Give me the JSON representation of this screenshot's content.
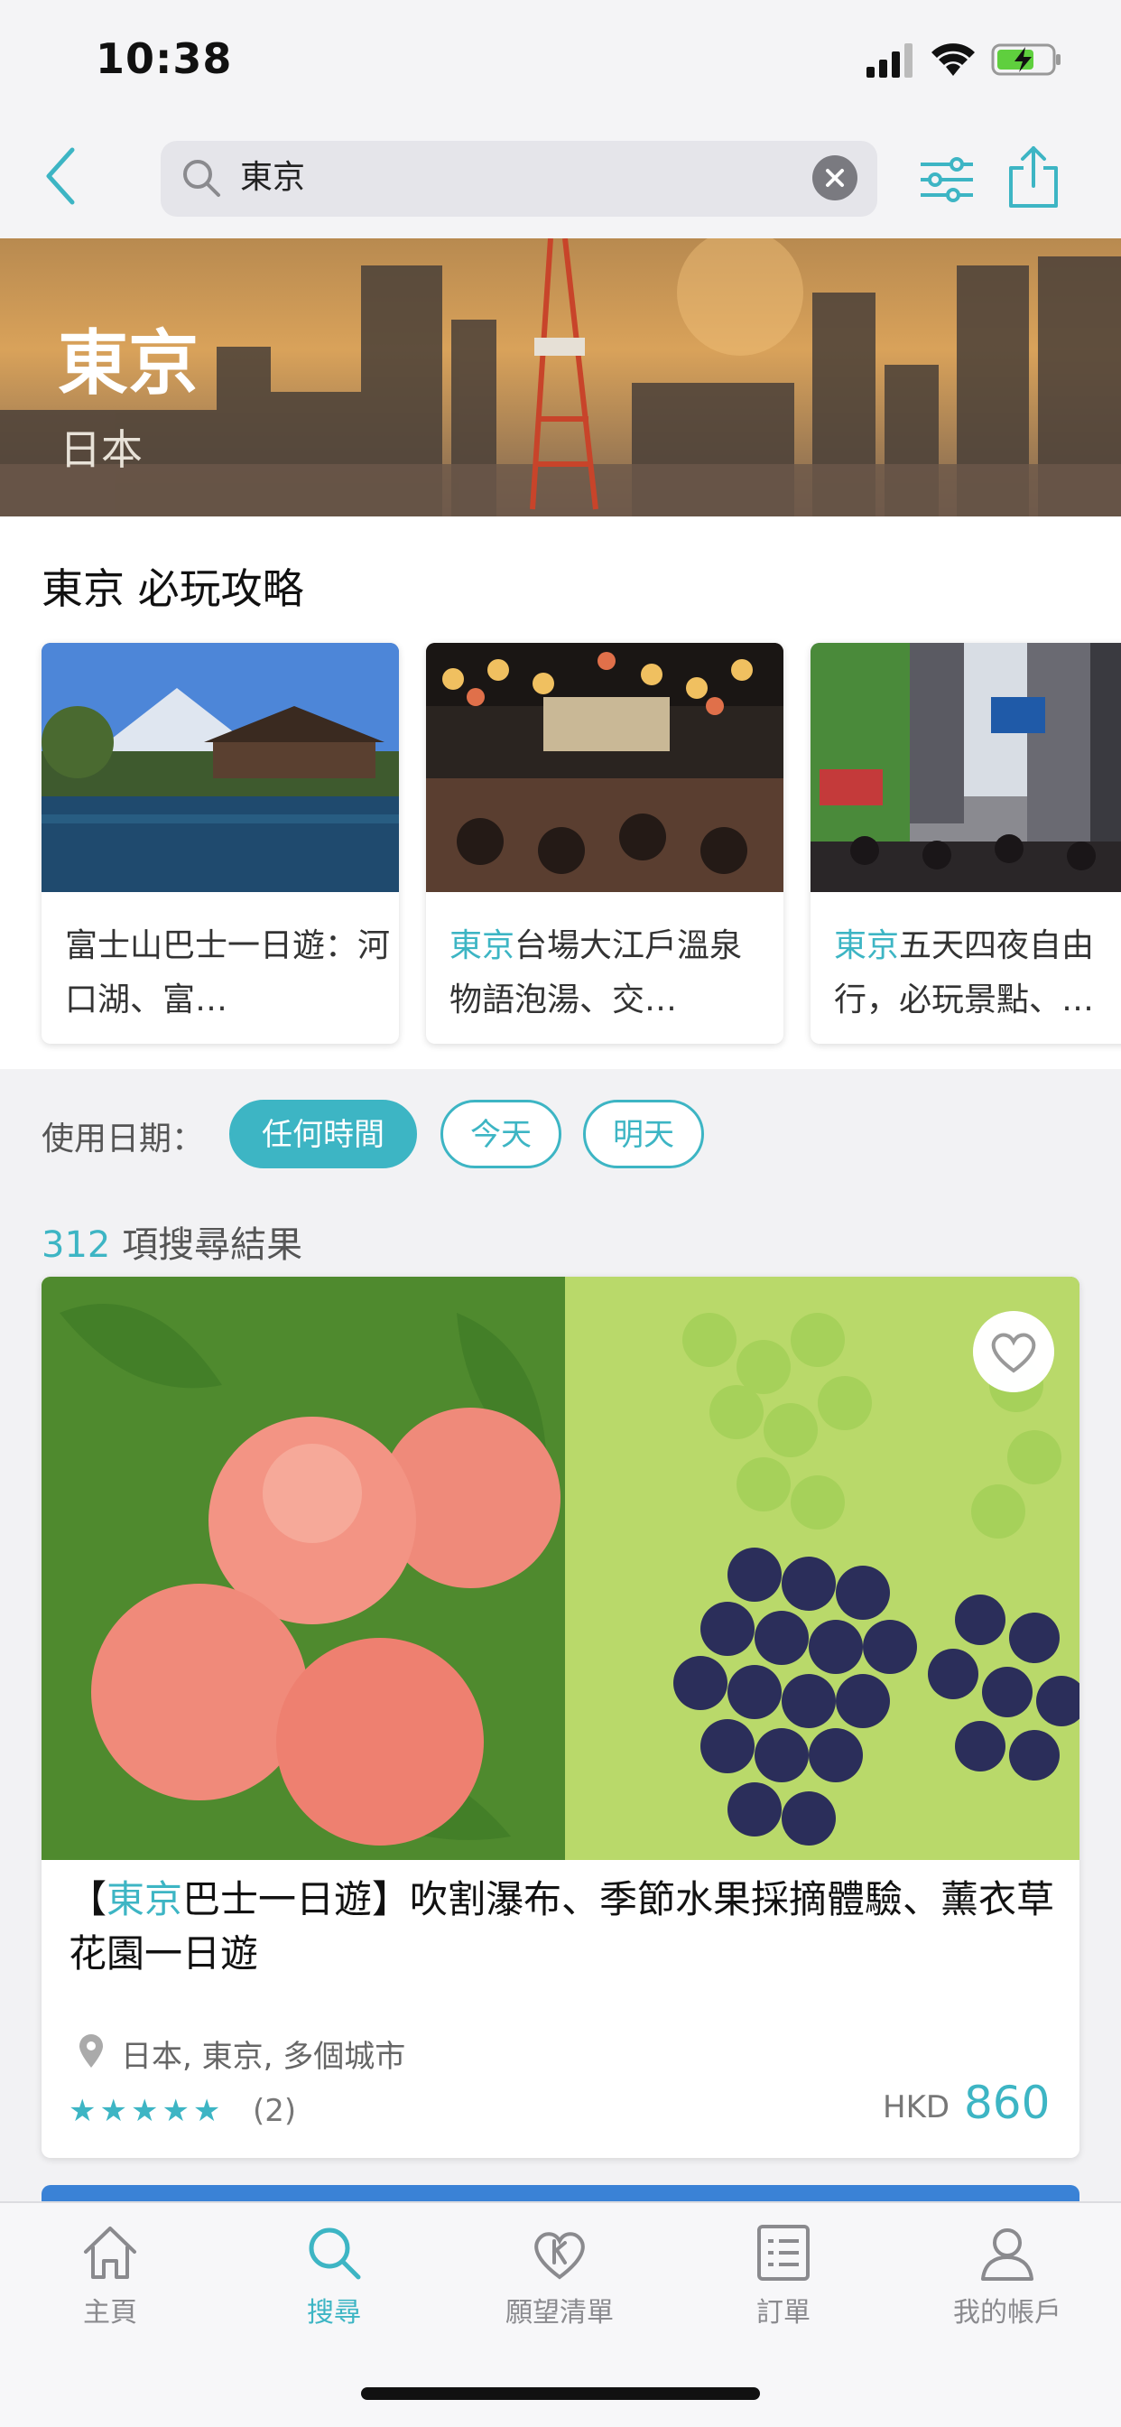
{
  "status_bar": {
    "time": "10:38"
  },
  "search": {
    "query": "東京"
  },
  "hero": {
    "title": "東京",
    "subtitle": "日本"
  },
  "section": {
    "title": "東京 必玩攻略",
    "cards": [
      {
        "highlight": "",
        "text": "富士山巴士一日遊：河口湖、富…"
      },
      {
        "highlight": "東京",
        "text": "台場大江戶溫泉物語泡湯、交…"
      },
      {
        "highlight": "東京",
        "text": "五天四夜自由行，必玩景點、…"
      }
    ]
  },
  "date_filter": {
    "label": "使用日期：",
    "options": [
      "任何時間",
      "今天",
      "明天"
    ],
    "selected": "任何時間"
  },
  "results": {
    "count": "312",
    "count_suffix": " 項搜尋結果",
    "items": [
      {
        "title_prefix": "【",
        "title_highlight": "東京",
        "title_rest": "巴士一日遊】吹割瀑布、季節水果採摘體驗、薰衣草花園一日遊",
        "location": "日本, 東京, 多個城市",
        "rating_stars": "★★★★★",
        "rating": 5,
        "reviews": "(2)",
        "currency": "HKD",
        "price": "860"
      }
    ]
  },
  "tabs": [
    {
      "label": "主頁",
      "icon": "home-icon",
      "active": false
    },
    {
      "label": "搜尋",
      "icon": "search-icon",
      "active": true
    },
    {
      "label": "願望清單",
      "icon": "wishlist-icon",
      "active": false
    },
    {
      "label": "訂單",
      "icon": "orders-icon",
      "active": false
    },
    {
      "label": "我的帳戶",
      "icon": "account-icon",
      "active": false
    }
  ],
  "colors": {
    "accent": "#3db5c4",
    "peek_card": "#3a82d6"
  }
}
